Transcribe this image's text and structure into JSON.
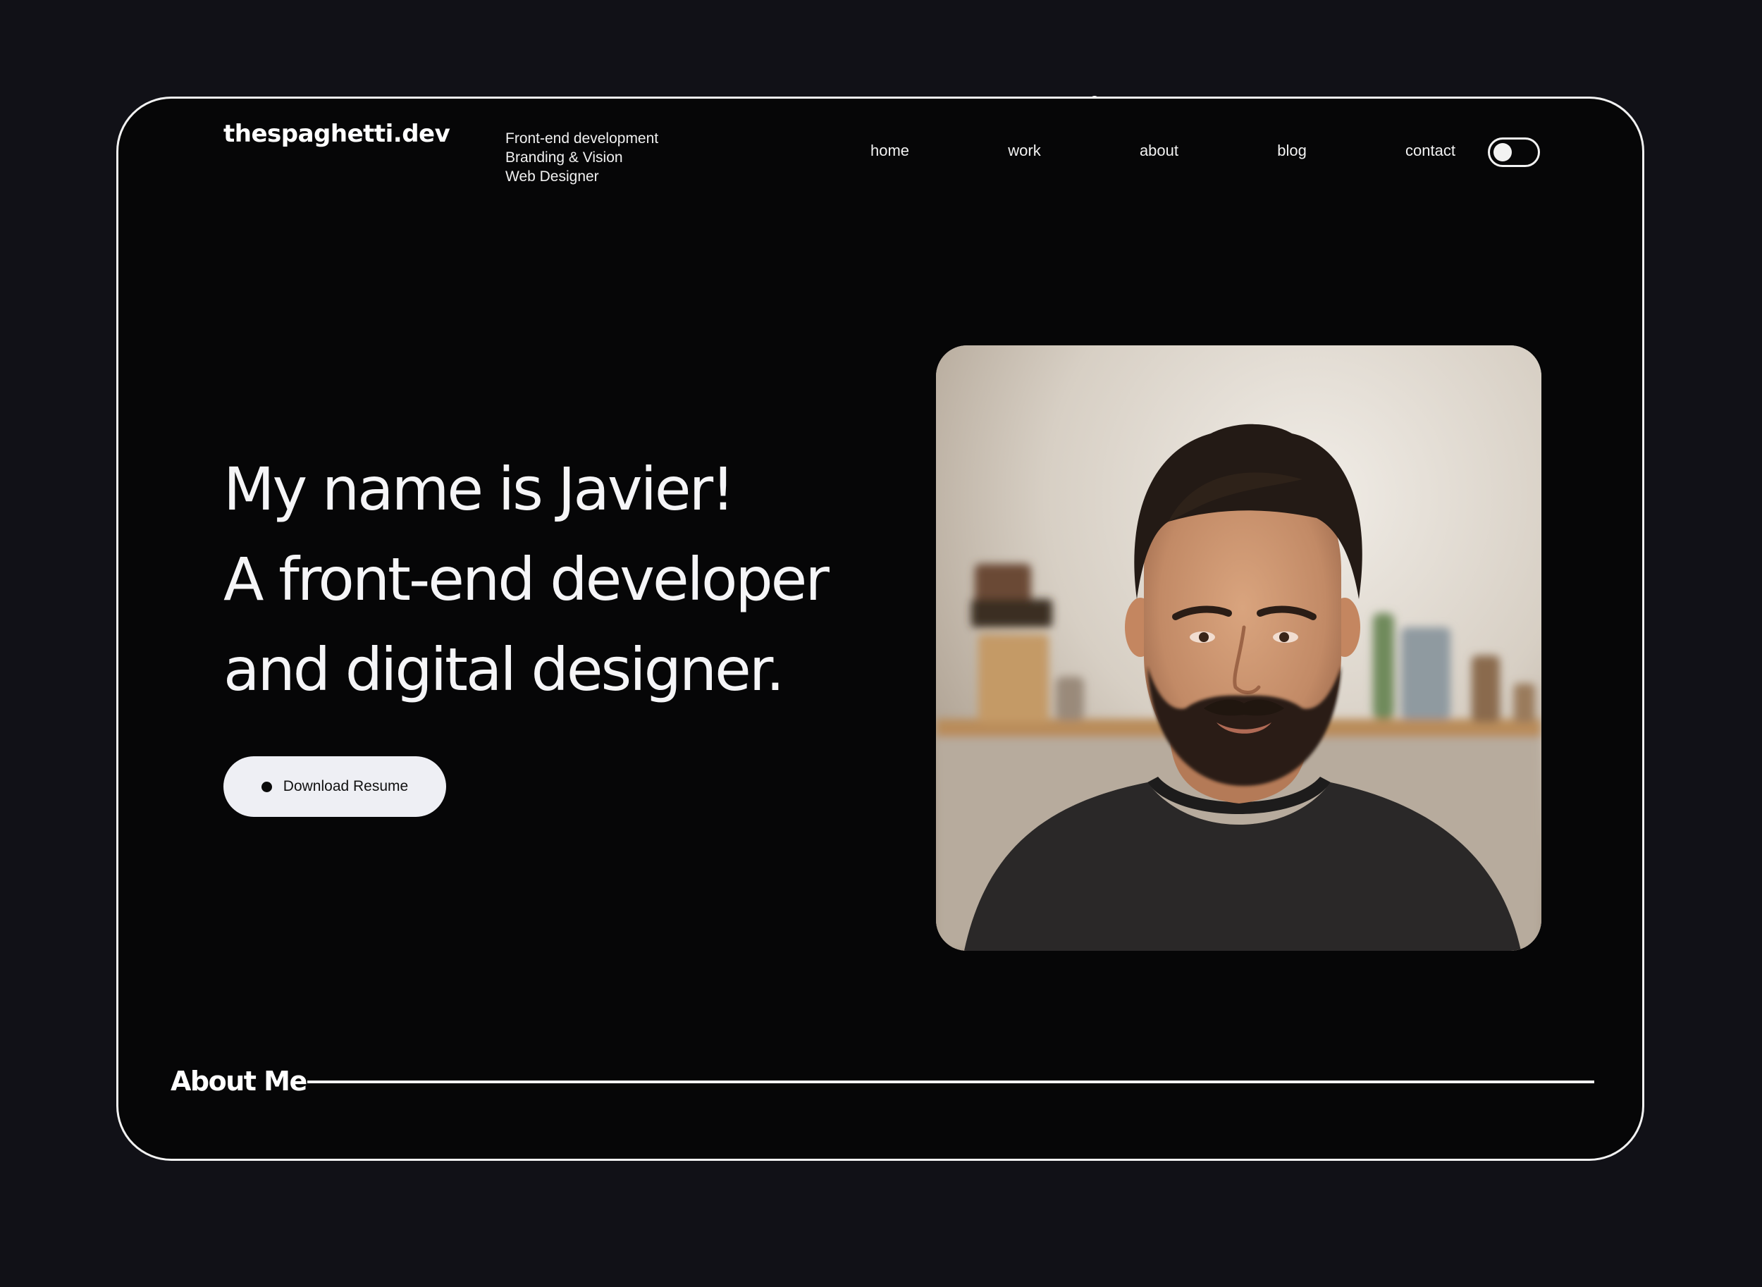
{
  "brand": {
    "logo": "thespaghetti.dev",
    "tagline": [
      "Front-end development",
      "Branding & Vision",
      "Web Designer"
    ]
  },
  "nav": {
    "items": [
      "home",
      "work",
      "about",
      "blog",
      "contact"
    ]
  },
  "theme_toggle": {
    "state": "on"
  },
  "hero": {
    "lines": [
      "My name is Javier!",
      "A front-end developer",
      "and digital designer."
    ],
    "resume_button": "Download Resume"
  },
  "about": {
    "heading": "About Me"
  },
  "colors": {
    "page_background": "#111117",
    "screen_background": "#060607",
    "frame": "#f2f2f2",
    "button_background": "#eeeff4",
    "text": "#f5f5f7"
  },
  "icons": {
    "resume_button_icon": "dot-icon",
    "theme_toggle_icon": "toggle-switch-icon"
  }
}
